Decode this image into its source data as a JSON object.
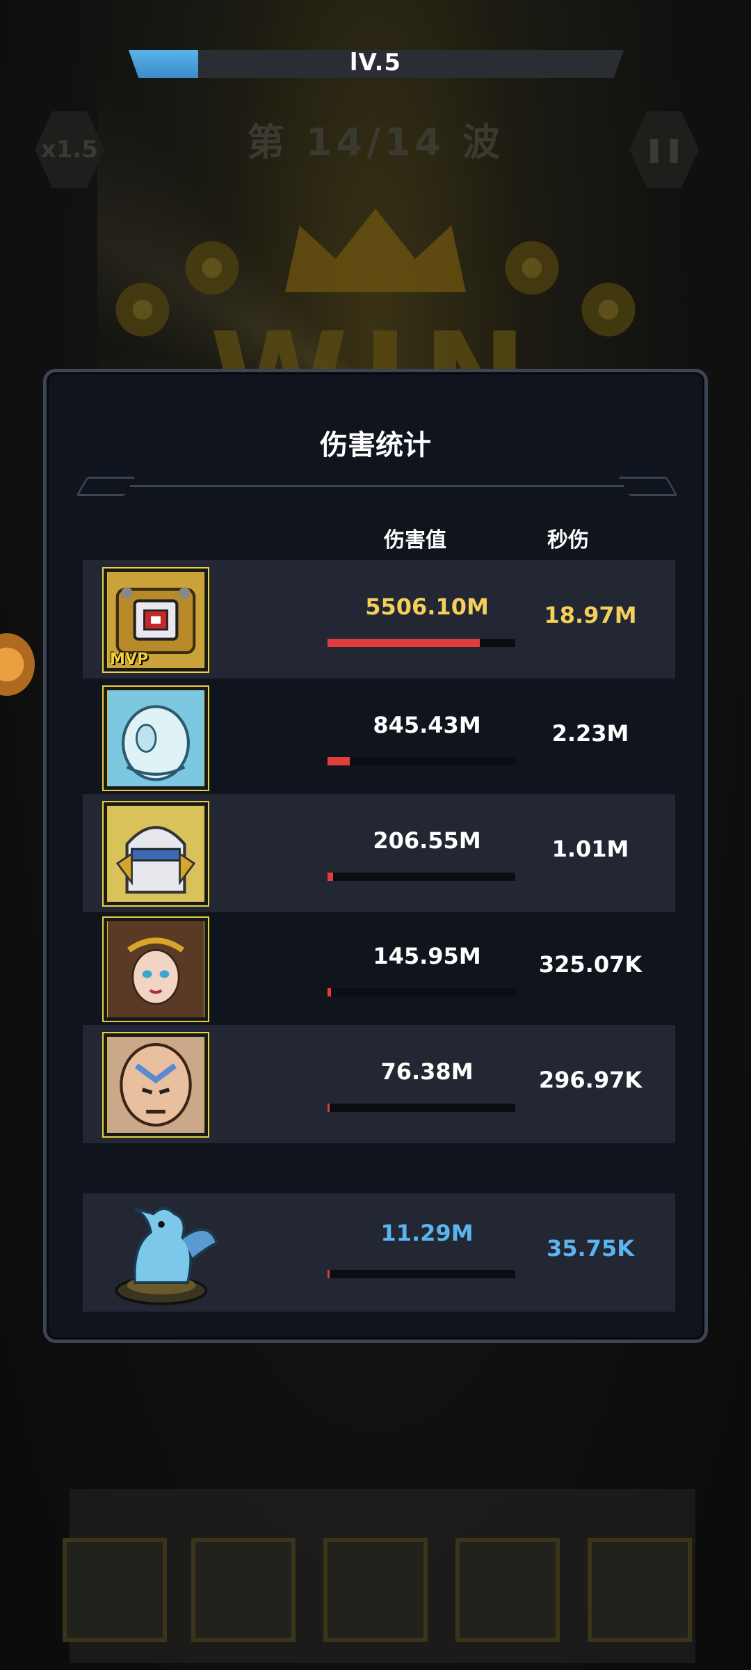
{
  "level": {
    "label": "lV.5",
    "progress_fraction": 0.14
  },
  "background": {
    "wave_text": "第 14/14 波",
    "speed_label": "x1.5",
    "win_text": "WIN"
  },
  "panel": {
    "title": "伤害统计",
    "headers": {
      "damage": "伤害值",
      "dps": "秒伤"
    }
  },
  "heroes": [
    {
      "name": "robot-hero",
      "damage": "5506.10M",
      "dps": "18.97M",
      "share": 0.81,
      "mvp": true,
      "mvp_label": "MVP",
      "highlight": "gold"
    },
    {
      "name": "ice-hero",
      "damage": "845.43M",
      "dps": "2.23M",
      "share": 0.12
    },
    {
      "name": "knight-hero",
      "damage": "206.55M",
      "dps": "1.01M",
      "share": 0.03
    },
    {
      "name": "goddess-hero",
      "damage": "145.95M",
      "dps": "325.07K",
      "share": 0.02
    },
    {
      "name": "monk-hero",
      "damage": "76.38M",
      "dps": "296.97K",
      "share": 0.01
    }
  ],
  "pet": {
    "name": "ice-dragon-pet",
    "damage": "11.29M",
    "dps": "35.75K",
    "share": 0.0
  },
  "colors": {
    "panel_bg": "#0f141d",
    "stripe": "#222733",
    "damage_bar": "#e23c3c",
    "gold_text": "#f4cf5a",
    "blue_text": "#5cb4ee",
    "level_fill": "#3a8ccb"
  }
}
